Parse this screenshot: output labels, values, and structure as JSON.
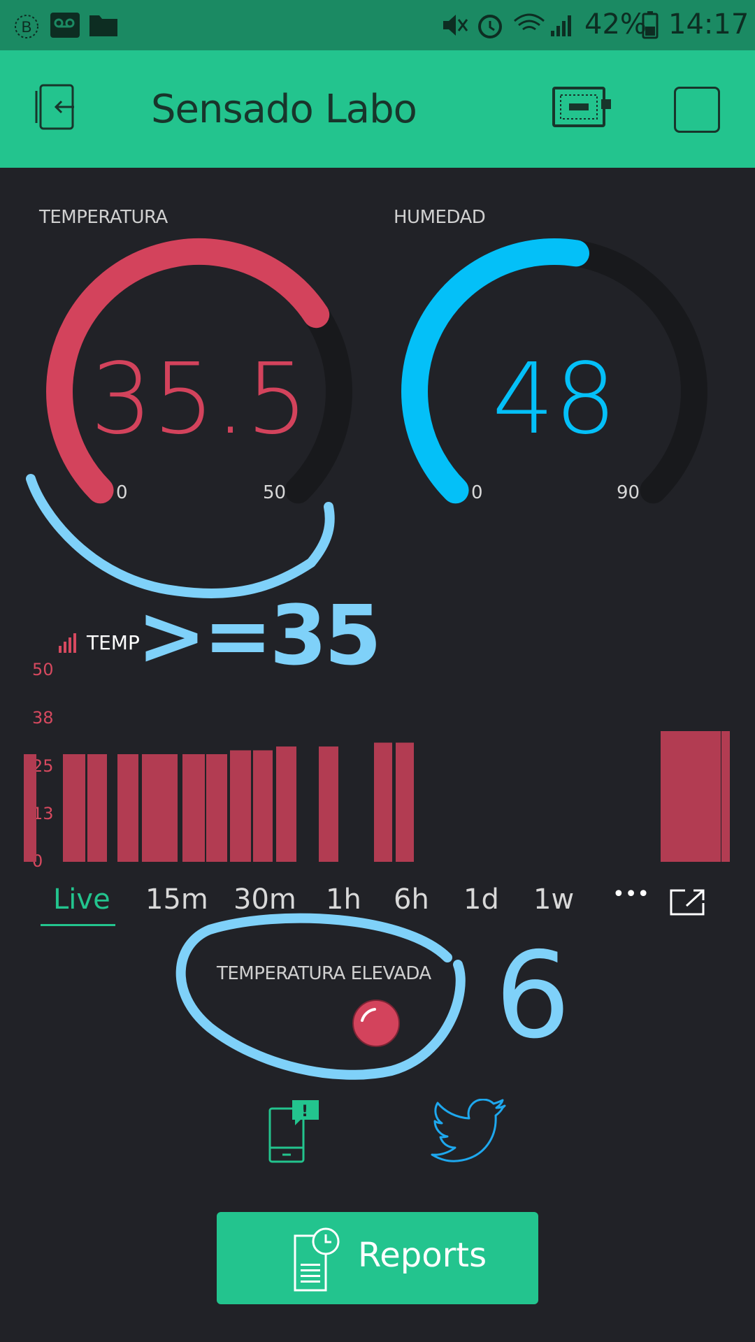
{
  "status_bar": {
    "battery": "42%",
    "time": "14:17",
    "icons": [
      "b-icon",
      "voicemail-icon",
      "folder-icon",
      "mute-icon",
      "alarm-icon",
      "wifi-icon",
      "signal-icon",
      "battery-icon"
    ]
  },
  "app_bar": {
    "title": "Sensado Labo",
    "icons": [
      "exit-icon",
      "device-icon",
      "square-icon"
    ]
  },
  "gauges": [
    {
      "label": "TEMPERATURA",
      "value": "35.5",
      "min": "0",
      "max": "50",
      "fraction": 0.71,
      "color": "#d3435c"
    },
    {
      "label": "HUMEDAD",
      "value": "48",
      "min": "0",
      "max": "90",
      "fraction": 0.533,
      "color": "#04c0f8"
    }
  ],
  "chart_data": {
    "type": "bar",
    "title": "TEMP",
    "ylim": [
      0,
      50
    ],
    "yticks": [
      "50",
      "38",
      "25",
      "13",
      "0"
    ],
    "values": [
      28,
      28,
      28,
      28,
      28,
      28,
      28,
      28,
      29,
      29,
      30,
      30,
      31,
      31,
      34,
      34,
      34
    ],
    "colors": {
      "bar": "#b23c52",
      "tick": "#d6495f"
    }
  },
  "time_tabs": {
    "items": [
      "Live",
      "15m",
      "30m",
      "1h",
      "6h",
      "1d",
      "1w"
    ],
    "active": "Live",
    "more": "•••"
  },
  "led": {
    "label": "TEMPERATURA ELEVADA",
    "color": "#d3435c"
  },
  "annotations": {
    "condition": ">=35",
    "number": "6"
  },
  "reports_button": {
    "label": "Reports"
  },
  "colors": {
    "accent": "#23c48e",
    "status": "#1b8a63",
    "background": "#212227",
    "annotation": "#7fd1f9"
  }
}
